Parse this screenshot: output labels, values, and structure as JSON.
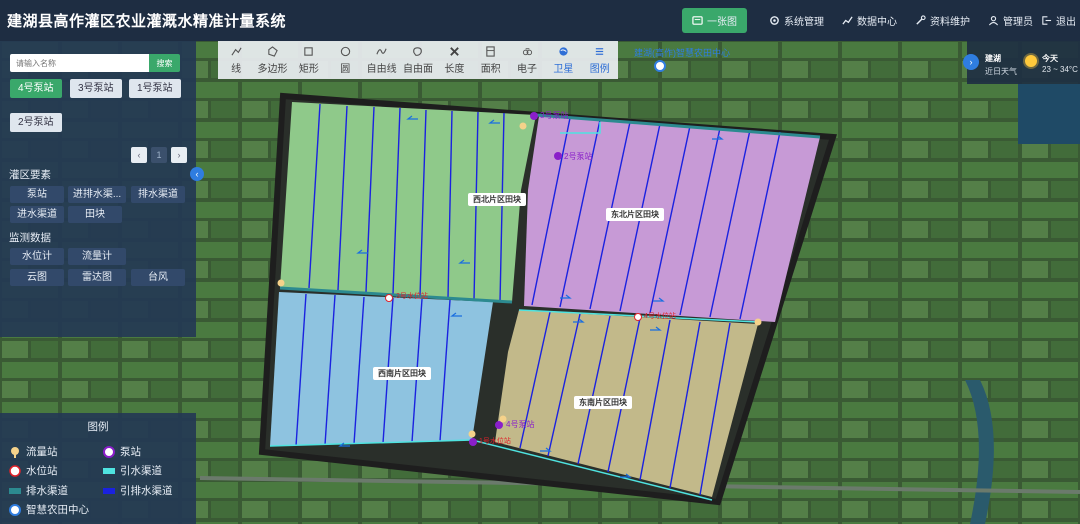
{
  "header": {
    "title": "建湖县高作灌区农业灌溉水精准计量系统",
    "nav": [
      {
        "label": "一张图",
        "active": true
      },
      {
        "label": "系统管理"
      },
      {
        "label": "数据中心"
      },
      {
        "label": "资料维护"
      },
      {
        "label": "管理员"
      },
      {
        "label": "退出"
      }
    ]
  },
  "search": {
    "placeholder": "请输入名称",
    "button": "搜索"
  },
  "stations": [
    "4号泵站",
    "3号泵站",
    "1号泵站",
    "2号泵站"
  ],
  "pager": {
    "page": "1"
  },
  "irrigation_elements": {
    "title": "灌区要素",
    "items": [
      "泵站",
      "进排水渠...",
      "排水渠道",
      "进水渠道",
      "田块"
    ]
  },
  "monitoring": {
    "title": "监测数据",
    "items": [
      "水位计",
      "流量计",
      "云图",
      "雷达图",
      "台风"
    ]
  },
  "toolbar": [
    "线",
    "多边形",
    "矩形",
    "圆",
    "自由线",
    "自由面",
    "长度",
    "面积",
    "电子",
    "卫星",
    "图例"
  ],
  "weather": {
    "city": "建湖",
    "sub": "近日天气",
    "today": "今天",
    "temp": "23 ~ 34°C"
  },
  "map": {
    "center_label": "建湖(高作)智慧农田中心",
    "regions": [
      "西北片区田块",
      "东北片区田块",
      "西南片区田块",
      "东南片区田块"
    ],
    "stations": [
      "2号泵站",
      "3号泵站",
      "4号泵站"
    ],
    "water_levels": [
      "3号水位站",
      "4号水位站",
      "1号水位站"
    ]
  },
  "legend": {
    "title": "图例",
    "items": [
      "流量站",
      "泵站",
      "水位站",
      "引水渠道",
      "排水渠道",
      "引排水渠道",
      "智慧农田中心"
    ]
  },
  "colors": {
    "header_bg": "#1e2d42",
    "accent_green": "#3aa86b",
    "accent_blue": "#2f7de0",
    "nw_fill": "#8fc98a",
    "ne_fill": "#c79ad6",
    "sw_fill": "#8ec3e0",
    "se_fill": "#c2b98a",
    "channel_blue": "#1a22e0",
    "channel_cyan": "#4fe3e0"
  }
}
